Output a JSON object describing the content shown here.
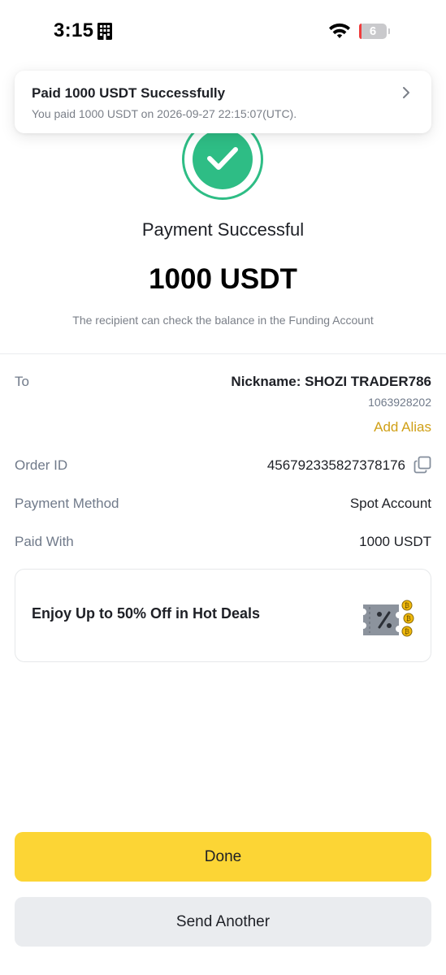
{
  "status_bar": {
    "time": "3:15",
    "battery_level": "6",
    "battery_fraction": 0.06,
    "icons": [
      "building-icon",
      "wifi-icon",
      "battery-icon"
    ]
  },
  "notification": {
    "title": "Paid 1000 USDT Successfully",
    "message": "You paid 1000 USDT on 2026-09-27 22:15:07(UTC).",
    "icon": "chevron-right-icon"
  },
  "result": {
    "icon": "check-circle-icon",
    "title": "Payment Successful",
    "amount": "1000 USDT",
    "hint": "The recipient can check the balance in the Funding Account"
  },
  "details": {
    "to_label": "To",
    "nickname": "Nickname: SHOZI TRADER786",
    "uid": "1063928202",
    "add_alias": "Add Alias",
    "order_id_label": "Order ID",
    "order_id": "456792335827378176",
    "payment_method_label": "Payment Method",
    "payment_method": "Spot Account",
    "paid_with_label": "Paid With",
    "paid_with": "1000 USDT"
  },
  "promo": {
    "text": "Enjoy Up to 50% Off in Hot Deals",
    "icon": "coupon-icon"
  },
  "buttons": {
    "done": "Done",
    "send_another": "Send Another"
  },
  "colors": {
    "accent_yellow": "#fcd535",
    "success_green": "#2ebd85",
    "alias_gold": "#d0a017",
    "battery_red": "#ef3b3b"
  }
}
